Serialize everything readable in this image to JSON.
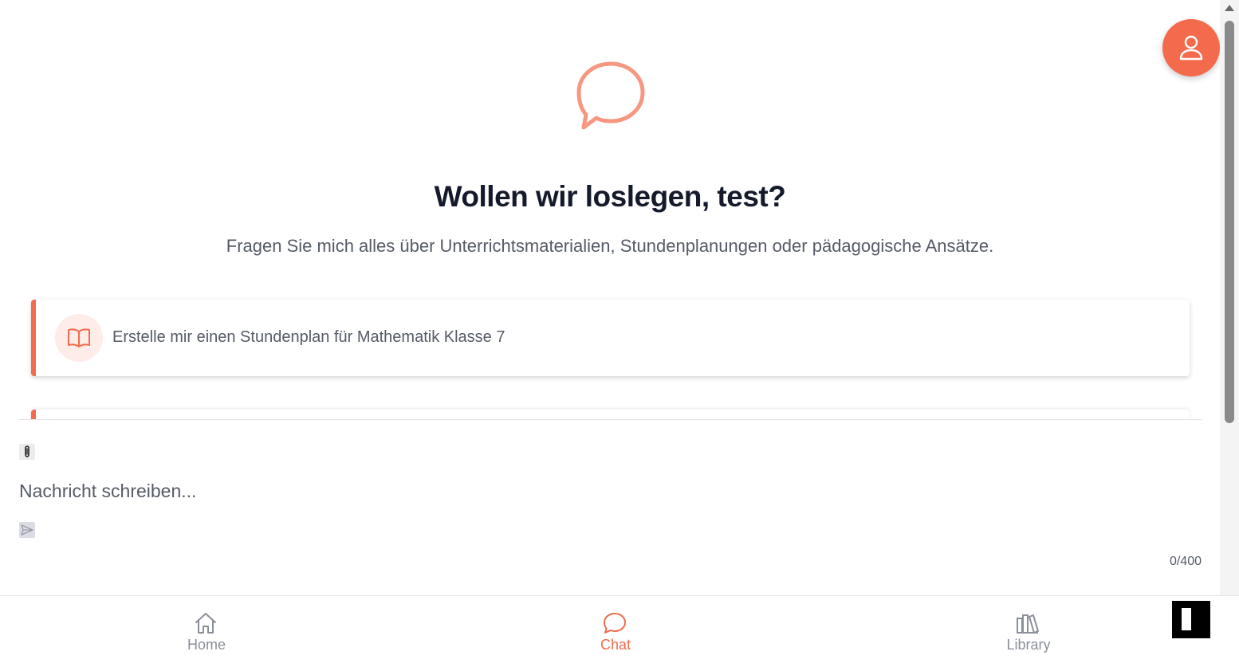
{
  "hero": {
    "title": "Wollen wir loslegen, test?",
    "subtitle": "Fragen Sie mich alles über Unterrichtsmaterialien, Stundenplanungen oder pädagogische Ansätze.",
    "icon": "chat-bubble-icon"
  },
  "suggestions": [
    {
      "label": "Erstelle mir einen Stundenplan für Mathematik Klasse 7",
      "icon": "book-open-icon"
    }
  ],
  "composer": {
    "placeholder": "Nachricht schreiben...",
    "value": "",
    "counter": "0/400",
    "attach_icon": "paperclip-icon",
    "send_icon": "send-icon"
  },
  "profile": {
    "icon": "user-icon"
  },
  "bottom_nav": {
    "items": [
      {
        "label": "Home",
        "icon": "home-icon",
        "active": false
      },
      {
        "label": "Chat",
        "icon": "chat-icon",
        "active": true
      },
      {
        "label": "Library",
        "icon": "library-icon",
        "active": false
      }
    ]
  },
  "colors": {
    "accent": "#f26b4d",
    "accent_light": "#fdece7",
    "title": "#141a2b",
    "muted_text": "#555b66",
    "nav_inactive": "#8a8f99"
  }
}
